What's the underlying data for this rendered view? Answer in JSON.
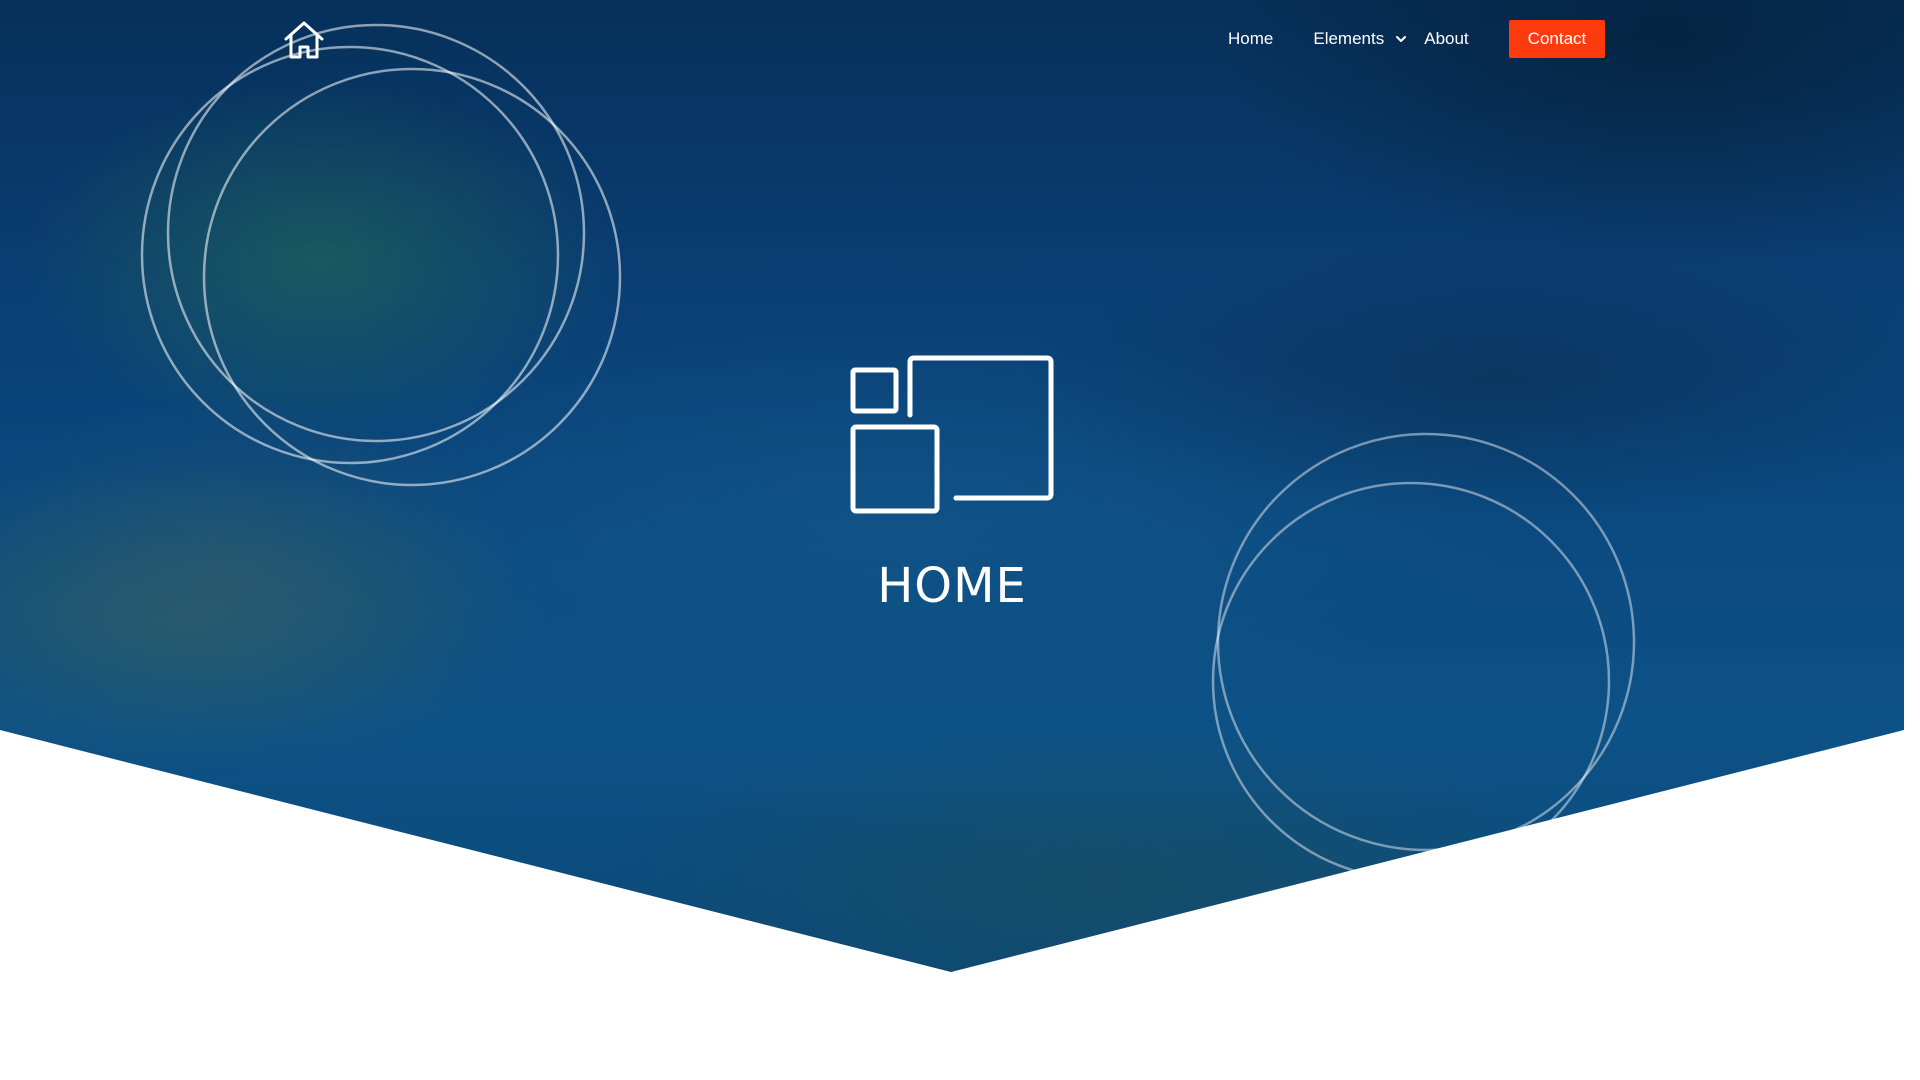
{
  "nav": {
    "logo_icon": "house-icon",
    "items": [
      {
        "label": "Home"
      },
      {
        "label": "Elements",
        "icon": "chevron-down-icon"
      },
      {
        "label": "About"
      }
    ],
    "contact_label": "Contact"
  },
  "hero": {
    "logo_icon": "windows-layout-icon",
    "title": "HOME",
    "overlay_color": "#0b4a80"
  },
  "colors": {
    "accent": "#ff3a0d",
    "nav_text": "#ffffff",
    "page_background": "#ffffff"
  }
}
